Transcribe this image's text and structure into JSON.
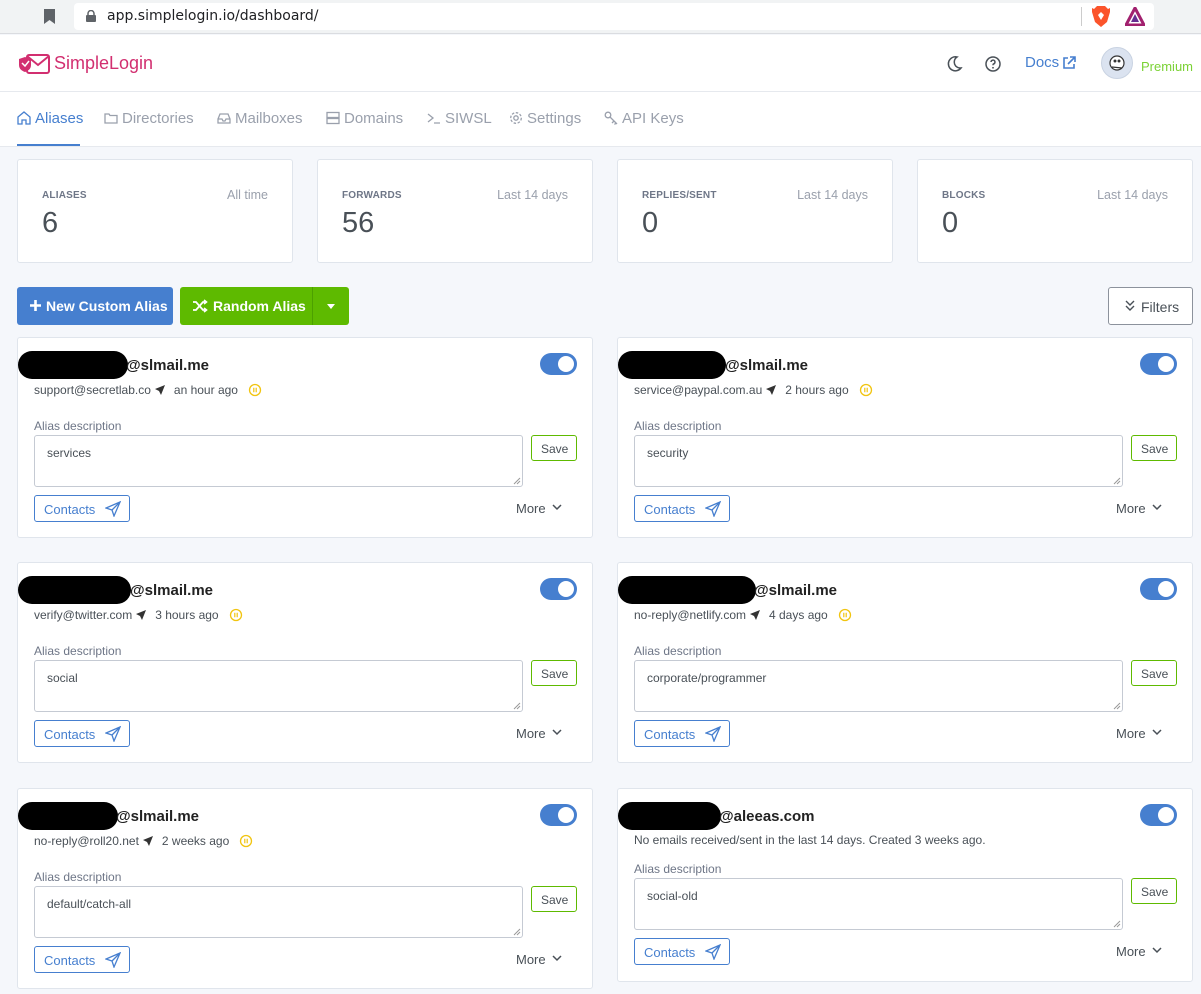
{
  "browser": {
    "url": "app.simplelogin.io/dashboard/"
  },
  "header": {
    "brand": "SimpleLogin",
    "docs_label": "Docs",
    "plan_label": "Premium",
    "brand_color": "#d22f70",
    "accent_color": "#467fcf"
  },
  "nav": {
    "tabs": [
      {
        "label": "Aliases",
        "icon": "home-icon",
        "active": true
      },
      {
        "label": "Directories",
        "icon": "folder-icon"
      },
      {
        "label": "Mailboxes",
        "icon": "inbox-icon"
      },
      {
        "label": "Domains",
        "icon": "server-icon"
      },
      {
        "label": "SIWSL",
        "icon": "terminal-icon"
      },
      {
        "label": "Settings",
        "icon": "gear-icon"
      },
      {
        "label": "API Keys",
        "icon": "key-icon"
      }
    ]
  },
  "stats": [
    {
      "label": "ALIASES",
      "range": "All time",
      "value": "6"
    },
    {
      "label": "FORWARDS",
      "range": "Last 14 days",
      "value": "56"
    },
    {
      "label": "REPLIES/SENT",
      "range": "Last 14 days",
      "value": "0"
    },
    {
      "label": "BLOCKS",
      "range": "Last 14 days",
      "value": "0"
    }
  ],
  "actions": {
    "new_alias": "New Custom Alias",
    "random_alias": "Random Alias",
    "filters": "Filters"
  },
  "card_labels": {
    "description": "Alias description",
    "save": "Save",
    "contacts": "Contacts",
    "more": "More"
  },
  "aliases": [
    {
      "email_domain": "@slmail.me",
      "sender": "support@secretlab.co",
      "time": "an hour ago",
      "description": "services",
      "enabled": true
    },
    {
      "email_domain": "@slmail.me",
      "sender": "service@paypal.com.au",
      "time": "2 hours ago",
      "description": "security",
      "enabled": true
    },
    {
      "email_domain": "@slmail.me",
      "sender": "verify@twitter.com",
      "time": "3 hours ago",
      "description": "social",
      "enabled": true
    },
    {
      "email_domain": "@slmail.me",
      "sender": "no-reply@netlify.com",
      "time": "4 days ago",
      "description": "corporate/programmer",
      "enabled": true
    },
    {
      "email_domain": "@slmail.me",
      "sender": "no-reply@roll20.net",
      "time": "2 weeks ago",
      "description": "default/catch-all",
      "enabled": true
    },
    {
      "email_domain": "@aleeas.com",
      "note": "No emails received/sent in the last 14 days. Created 3 weeks ago.",
      "description": "social-old",
      "enabled": true
    }
  ]
}
